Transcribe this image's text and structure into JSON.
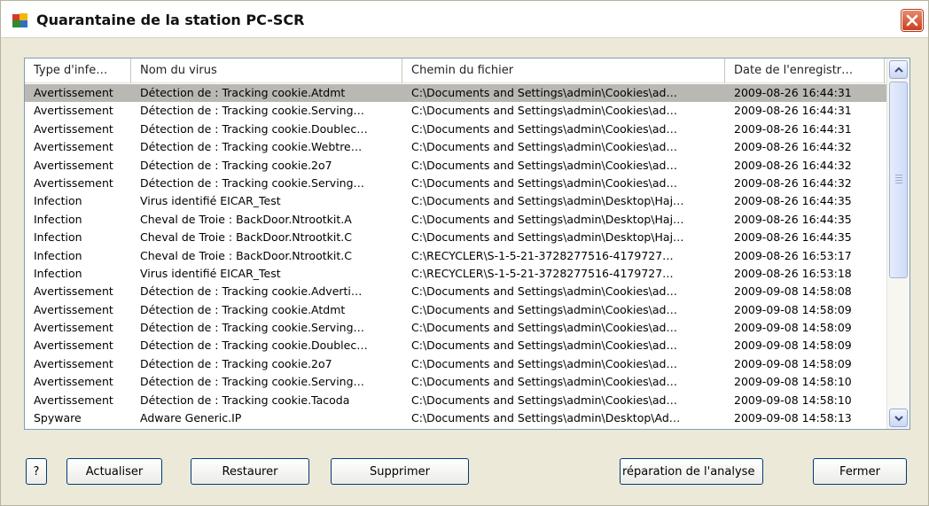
{
  "window": {
    "title": "Quarantaine de la station PC-SCR"
  },
  "columns": [
    "Type d'infe…",
    "Nom du virus",
    "Chemin du fichier",
    "Date de l'enregistr…"
  ],
  "rows": [
    {
      "type": "Avertissement",
      "virus": "Détection de : Tracking cookie.Atdmt",
      "path": "C:\\Documents and Settings\\admin\\Cookies\\ad…",
      "date": "2009-08-26 16:44:31"
    },
    {
      "type": "Avertissement",
      "virus": "Détection de : Tracking cookie.Serving…",
      "path": "C:\\Documents and Settings\\admin\\Cookies\\ad…",
      "date": "2009-08-26 16:44:31"
    },
    {
      "type": "Avertissement",
      "virus": "Détection de : Tracking cookie.Doublec…",
      "path": "C:\\Documents and Settings\\admin\\Cookies\\ad…",
      "date": "2009-08-26 16:44:31"
    },
    {
      "type": "Avertissement",
      "virus": "Détection de : Tracking cookie.Webtre…",
      "path": "C:\\Documents and Settings\\admin\\Cookies\\ad…",
      "date": "2009-08-26 16:44:32"
    },
    {
      "type": "Avertissement",
      "virus": "Détection de : Tracking cookie.2o7",
      "path": "C:\\Documents and Settings\\admin\\Cookies\\ad…",
      "date": "2009-08-26 16:44:32"
    },
    {
      "type": "Avertissement",
      "virus": "Détection de : Tracking cookie.Serving…",
      "path": "C:\\Documents and Settings\\admin\\Cookies\\ad…",
      "date": "2009-08-26 16:44:32"
    },
    {
      "type": "Infection",
      "virus": "Virus identifié EICAR_Test",
      "path": "C:\\Documents and Settings\\admin\\Desktop\\Haj…",
      "date": "2009-08-26 16:44:35"
    },
    {
      "type": "Infection",
      "virus": "Cheval de Troie : BackDoor.Ntrootkit.A",
      "path": "C:\\Documents and Settings\\admin\\Desktop\\Haj…",
      "date": "2009-08-26 16:44:35"
    },
    {
      "type": "Infection",
      "virus": "Cheval de Troie : BackDoor.Ntrootkit.C",
      "path": "C:\\Documents and Settings\\admin\\Desktop\\Haj…",
      "date": "2009-08-26 16:44:35"
    },
    {
      "type": "Infection",
      "virus": "Cheval de Troie : BackDoor.Ntrootkit.C",
      "path": "C:\\RECYCLER\\S-1-5-21-3728277516-4179727…",
      "date": "2009-08-26 16:53:17"
    },
    {
      "type": "Infection",
      "virus": "Virus identifié EICAR_Test",
      "path": "C:\\RECYCLER\\S-1-5-21-3728277516-4179727…",
      "date": "2009-08-26 16:53:18"
    },
    {
      "type": "Avertissement",
      "virus": "Détection de : Tracking cookie.Adverti…",
      "path": "C:\\Documents and Settings\\admin\\Cookies\\ad…",
      "date": "2009-09-08 14:58:08"
    },
    {
      "type": "Avertissement",
      "virus": "Détection de : Tracking cookie.Atdmt",
      "path": "C:\\Documents and Settings\\admin\\Cookies\\ad…",
      "date": "2009-09-08 14:58:09"
    },
    {
      "type": "Avertissement",
      "virus": "Détection de : Tracking cookie.Serving…",
      "path": "C:\\Documents and Settings\\admin\\Cookies\\ad…",
      "date": "2009-09-08 14:58:09"
    },
    {
      "type": "Avertissement",
      "virus": "Détection de : Tracking cookie.Doublec…",
      "path": "C:\\Documents and Settings\\admin\\Cookies\\ad…",
      "date": "2009-09-08 14:58:09"
    },
    {
      "type": "Avertissement",
      "virus": "Détection de : Tracking cookie.2o7",
      "path": "C:\\Documents and Settings\\admin\\Cookies\\ad…",
      "date": "2009-09-08 14:58:09"
    },
    {
      "type": "Avertissement",
      "virus": "Détection de : Tracking cookie.Serving…",
      "path": "C:\\Documents and Settings\\admin\\Cookies\\ad…",
      "date": "2009-09-08 14:58:10"
    },
    {
      "type": "Avertissement",
      "virus": "Détection de : Tracking cookie.Tacoda",
      "path": "C:\\Documents and Settings\\admin\\Cookies\\ad…",
      "date": "2009-09-08 14:58:10"
    },
    {
      "type": "Spyware",
      "virus": "Adware Generic.IP",
      "path": "C:\\Documents and Settings\\admin\\Desktop\\Ad…",
      "date": "2009-09-08 14:58:13"
    }
  ],
  "selected_row": 0,
  "buttons": {
    "help": "?",
    "refresh": "Actualiser",
    "restore": "Restaurer",
    "delete": "Supprimer",
    "repair": "réparation de l'analyse",
    "close": "Fermer"
  },
  "icons": {
    "app": "avg-logo-icon",
    "close": "close-icon",
    "scroll_up": "scroll-up-arrow-icon",
    "scroll_down": "scroll-down-arrow-icon"
  },
  "colors": {
    "selected_row": "#b9b8b2",
    "close_button": "#c9401f",
    "dialog_bg": "#ece9d8"
  }
}
